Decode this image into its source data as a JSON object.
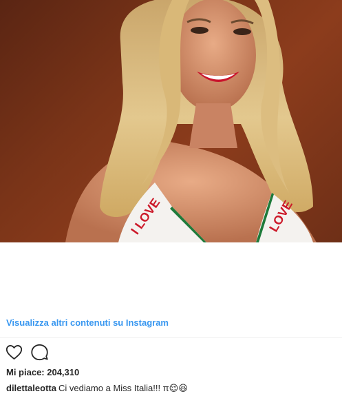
{
  "post": {
    "image_alt": "Photo of a smiling blonde woman wearing a white top with red 'I LOVE' lettering",
    "top_lettering": [
      "I LOVE",
      "LOVE"
    ]
  },
  "view_more_label": "Visualizza altri contenuti su Instagram",
  "actions": {
    "like_icon": "heart-outline-icon",
    "comment_icon": "speech-bubble-icon"
  },
  "likes": {
    "text": "Mi piace: 204,310"
  },
  "caption": {
    "username": "dilettaleotta",
    "text": "Ci vediamo a Miss Italia!!! π😌😆"
  },
  "colors": {
    "link_blue": "#3897f0",
    "text": "#262626",
    "background_brown": "#7a3418"
  }
}
